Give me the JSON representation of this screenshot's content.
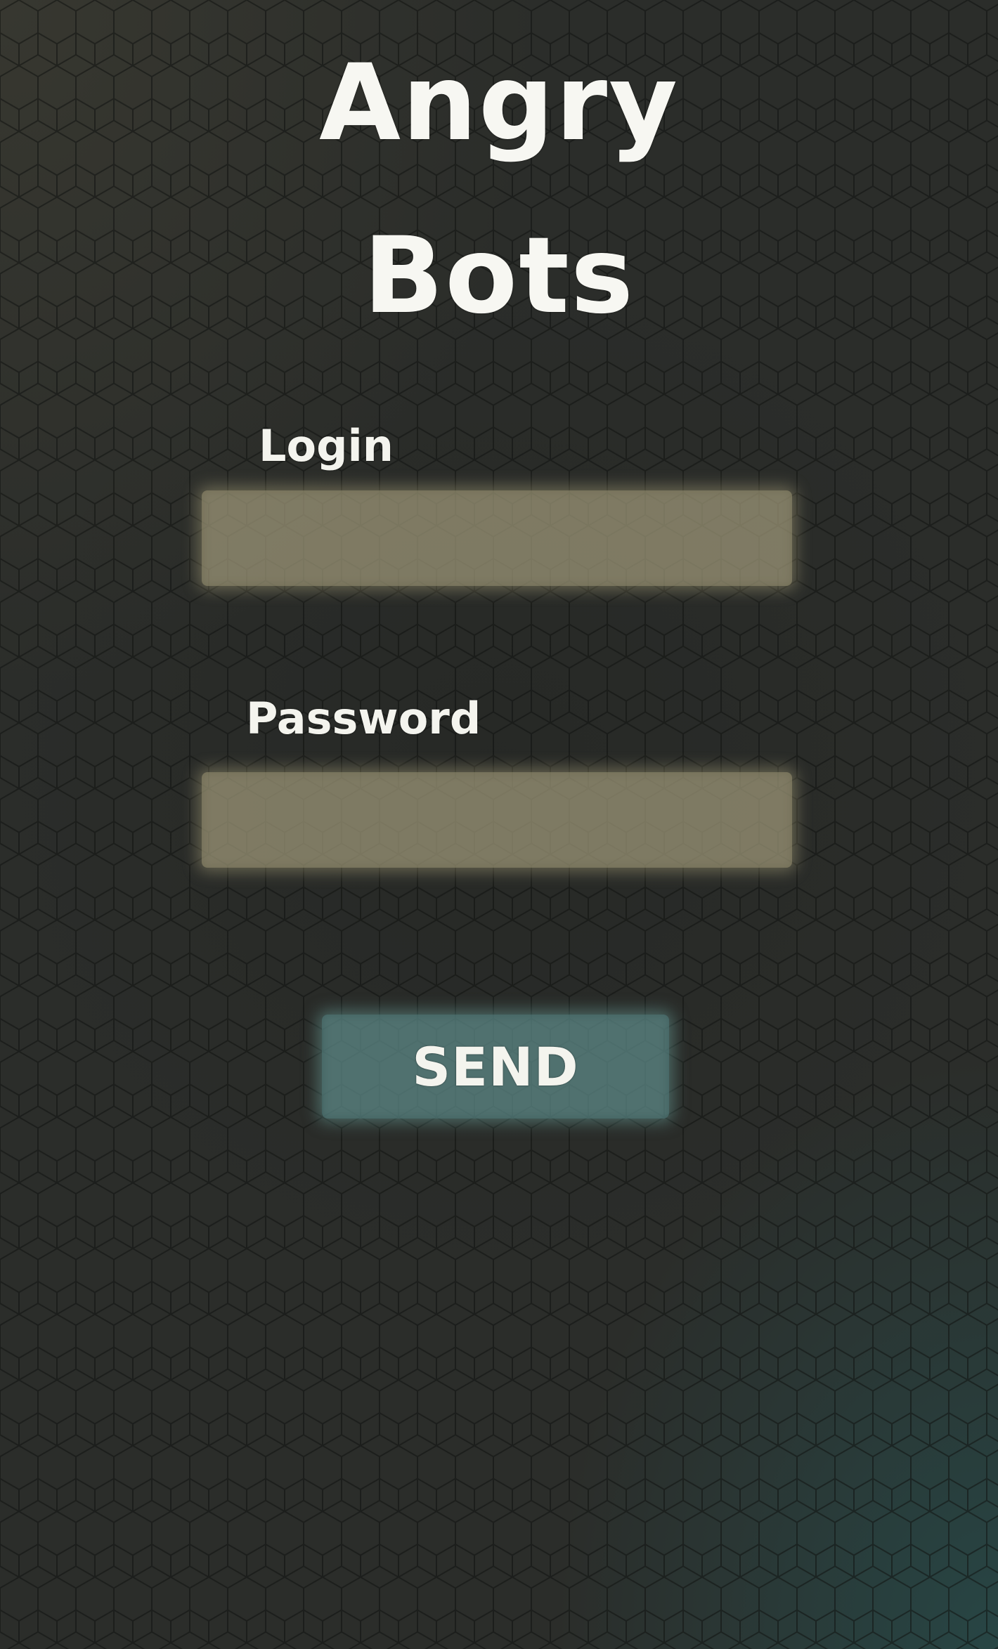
{
  "app": {
    "title_line1": "Angry",
    "title_line2": "Bots"
  },
  "form": {
    "login_label": "Login",
    "login_value": "",
    "password_label": "Password",
    "password_value": "",
    "send_label": "SEND"
  },
  "colors": {
    "background": "#2b2d2a",
    "field": "#a8a080",
    "button": "#608c8a",
    "text": "#f7f7f2"
  }
}
